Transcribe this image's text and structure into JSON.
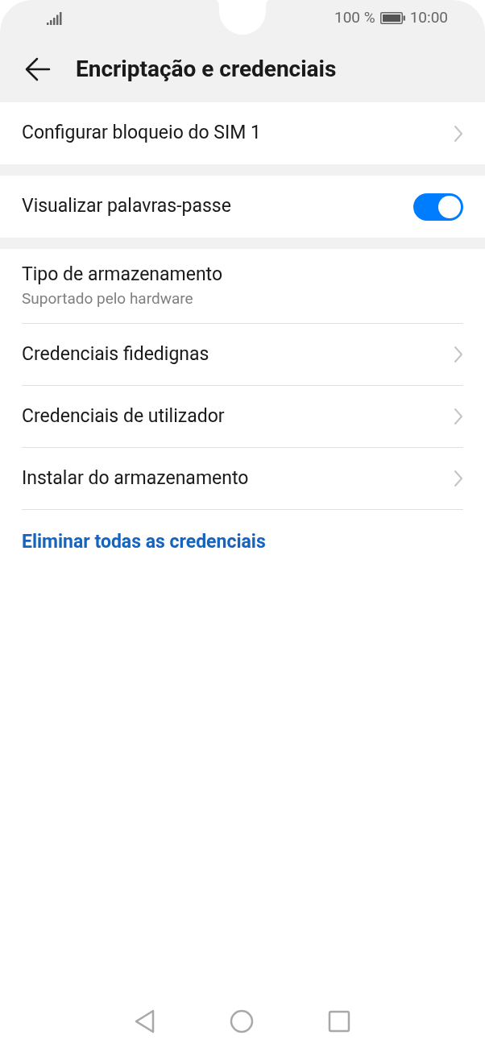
{
  "status_bar": {
    "battery": "100 %",
    "time": "10:00"
  },
  "header": {
    "title": "Encriptação e credenciais"
  },
  "sections": [
    {
      "rows": [
        {
          "kind": "link",
          "label": "Configurar bloqueio do SIM 1"
        }
      ]
    },
    {
      "rows": [
        {
          "kind": "toggle",
          "label": "Visualizar palavras-passe",
          "on": true
        }
      ]
    },
    {
      "rows": [
        {
          "kind": "info",
          "label": "Tipo de armazenamento",
          "subtitle": "Suportado pelo hardware"
        },
        {
          "kind": "link",
          "label": "Credenciais fidedignas"
        },
        {
          "kind": "link",
          "label": "Credenciais de utilizador"
        },
        {
          "kind": "link",
          "label": "Instalar do armazenamento"
        },
        {
          "kind": "action",
          "label": "Eliminar todas as credenciais"
        }
      ]
    }
  ]
}
